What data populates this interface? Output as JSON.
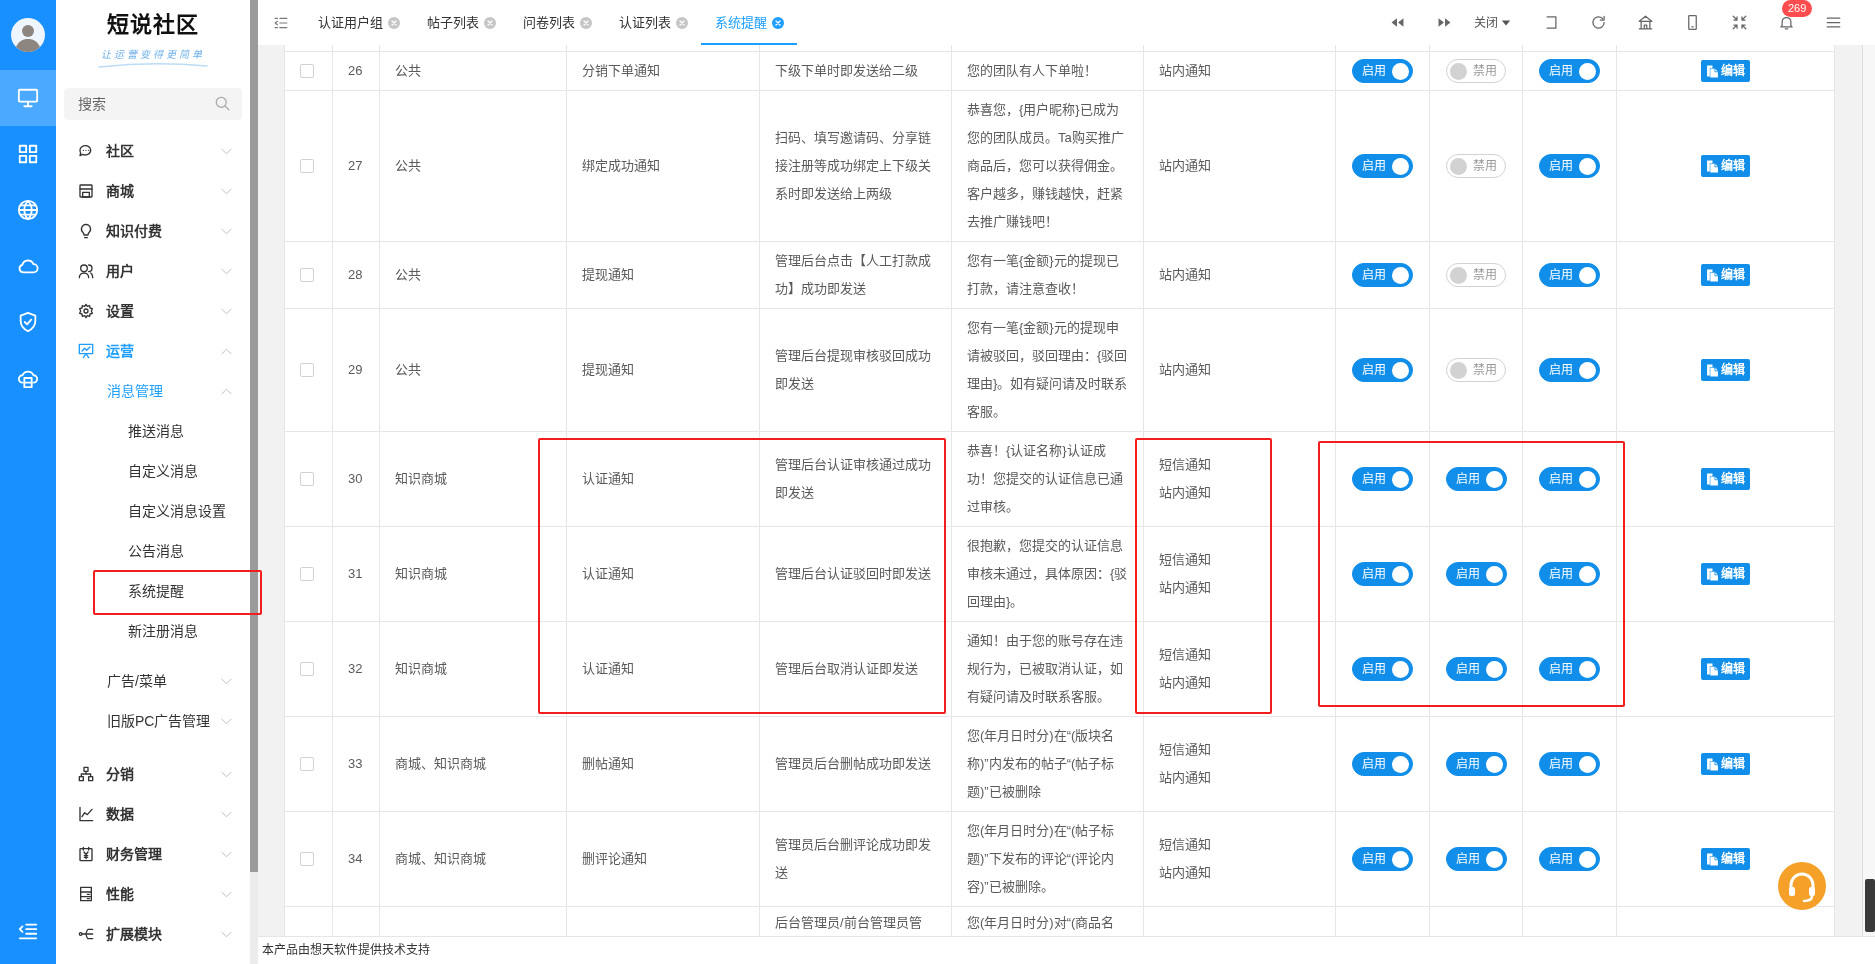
{
  "rail": {
    "items": [
      {
        "selected": true
      },
      {
        "selected": false
      },
      {
        "selected": false
      },
      {
        "selected": false
      },
      {
        "selected": false
      },
      {
        "selected": false
      }
    ]
  },
  "sidebar": {
    "logo": "短说社区",
    "tagline": "让运营变得更简单",
    "search": {
      "placeholder": "搜索"
    },
    "items": [
      {
        "label": "社区",
        "expanded": false
      },
      {
        "label": "商城",
        "expanded": false
      },
      {
        "label": "知识付费",
        "expanded": false
      },
      {
        "label": "用户",
        "expanded": false
      },
      {
        "label": "设置",
        "expanded": false
      },
      {
        "label": "运营",
        "expanded": true,
        "children": [
          {
            "label": "消息管理",
            "expanded": true,
            "children": [
              {
                "label": "推送消息",
                "selected": false,
                "framed": false
              },
              {
                "label": "自定义消息",
                "selected": false,
                "framed": false
              },
              {
                "label": "自定义消息设置",
                "selected": false,
                "framed": false
              },
              {
                "label": "公告消息",
                "selected": false,
                "framed": false
              },
              {
                "label": "系统提醒",
                "selected": false,
                "framed": true
              },
              {
                "label": "新注册消息",
                "selected": false,
                "framed": false
              }
            ]
          },
          {
            "label": "广告/菜单",
            "expanded": false
          },
          {
            "label": "旧版PC广告管理",
            "expanded": false
          }
        ]
      },
      {
        "label": "分销",
        "expanded": false
      },
      {
        "label": "数据",
        "expanded": false
      },
      {
        "label": "财务管理",
        "expanded": false
      },
      {
        "label": "性能",
        "expanded": false
      },
      {
        "label": "扩展模块",
        "expanded": false
      }
    ]
  },
  "tabs": [
    {
      "label": "认证用户组",
      "selected": false
    },
    {
      "label": "帖子列表",
      "selected": false
    },
    {
      "label": "问卷列表",
      "selected": false
    },
    {
      "label": "认证列表",
      "selected": false
    },
    {
      "label": "系统提醒",
      "selected": true
    }
  ],
  "toolbar": {
    "close_menu": "关闭",
    "notification_count": "269"
  },
  "table": {
    "frames": [
      {
        "kind": "text"
      },
      {
        "kind": "channels"
      },
      {
        "kind": "switches"
      }
    ],
    "rows": [
      {
        "checked": false,
        "id": "26",
        "category": "公共",
        "name": "分销下单通知",
        "trigger": "下级下单时即发送给二级",
        "content": "您的团队有人下单啦！",
        "channels": [
          "站内通知"
        ],
        "switches": [
          {
            "label": "启用",
            "on": true
          },
          {
            "label": "禁用",
            "on": false
          },
          {
            "label": "启用",
            "on": true
          }
        ],
        "action": "编辑",
        "framed": false
      },
      {
        "checked": false,
        "id": "27",
        "category": "公共",
        "name": "绑定成功通知",
        "trigger": "扫码、填写邀请码、分享链接注册等成功绑定上下级关系时即发送给上两级",
        "content": "恭喜您，{用户昵称}已成为您的团队成员。Ta购买推广商品后，您可以获得佣金。客户越多，赚钱越快，赶紧去推广赚钱吧！",
        "channels": [
          "站内通知"
        ],
        "switches": [
          {
            "label": "启用",
            "on": true
          },
          {
            "label": "禁用",
            "on": false
          },
          {
            "label": "启用",
            "on": true
          }
        ],
        "action": "编辑",
        "framed": false
      },
      {
        "checked": false,
        "id": "28",
        "category": "公共",
        "name": "提现通知",
        "trigger": "管理后台点击【人工打款成功】成功即发送",
        "content": "您有一笔{金额}元的提现已打款，请注意查收！",
        "channels": [
          "站内通知"
        ],
        "switches": [
          {
            "label": "启用",
            "on": true
          },
          {
            "label": "禁用",
            "on": false
          },
          {
            "label": "启用",
            "on": true
          }
        ],
        "action": "编辑",
        "framed": false
      },
      {
        "checked": false,
        "id": "29",
        "category": "公共",
        "name": "提现通知",
        "trigger": "管理后台提现审核驳回成功即发送",
        "content": "您有一笔{金额}元的提现申请被驳回，驳回理由：{驳回理由}。如有疑问请及时联系客服。",
        "channels": [
          "站内通知"
        ],
        "switches": [
          {
            "label": "启用",
            "on": true
          },
          {
            "label": "禁用",
            "on": false
          },
          {
            "label": "启用",
            "on": true
          }
        ],
        "action": "编辑",
        "framed": false
      },
      {
        "checked": false,
        "id": "30",
        "category": "知识商城",
        "name": "认证通知",
        "trigger": "管理后台认证审核通过成功即发送",
        "content": "恭喜！{认证名称}认证成功！您提交的认证信息已通过审核。",
        "channels": [
          "短信通知",
          "站内通知"
        ],
        "switches": [
          {
            "label": "启用",
            "on": true
          },
          {
            "label": "启用",
            "on": true
          },
          {
            "label": "启用",
            "on": true
          }
        ],
        "action": "编辑",
        "framed": true
      },
      {
        "checked": false,
        "id": "31",
        "category": "知识商城",
        "name": "认证通知",
        "trigger": "管理后台认证驳回时即发送",
        "content": "很抱歉，您提交的认证信息审核未通过，具体原因：{驳回理由}。",
        "channels": [
          "短信通知",
          "站内通知"
        ],
        "switches": [
          {
            "label": "启用",
            "on": true
          },
          {
            "label": "启用",
            "on": true
          },
          {
            "label": "启用",
            "on": true
          }
        ],
        "action": "编辑",
        "framed": true
      },
      {
        "checked": false,
        "id": "32",
        "category": "知识商城",
        "name": "认证通知",
        "trigger": "管理后台取消认证即发送",
        "content": "通知！由于您的账号存在违规行为，已被取消认证，如有疑问请及时联系客服。",
        "channels": [
          "短信通知",
          "站内通知"
        ],
        "switches": [
          {
            "label": "启用",
            "on": true
          },
          {
            "label": "启用",
            "on": true
          },
          {
            "label": "启用",
            "on": true
          }
        ],
        "action": "编辑",
        "framed": true
      },
      {
        "checked": false,
        "id": "33",
        "category": "商城、知识商城",
        "name": "删帖通知",
        "trigger": "管理员后台删帖成功即发送",
        "content": "您(年月日时分)在“(版块名称)”内发布的帖子“(帖子标题)”已被删除",
        "channels": [
          "短信通知",
          "站内通知"
        ],
        "switches": [
          {
            "label": "启用",
            "on": true
          },
          {
            "label": "启用",
            "on": true
          },
          {
            "label": "启用",
            "on": true
          }
        ],
        "action": "编辑",
        "framed": false
      },
      {
        "checked": false,
        "id": "34",
        "category": "商城、知识商城",
        "name": "删评论通知",
        "trigger": "管理员后台删评论成功即发送",
        "content": "您(年月日时分)在“(帖子标题)”下发布的评论“(评论内容)”已被删除。",
        "channels": [
          "短信通知",
          "站内通知"
        ],
        "switches": [
          {
            "label": "启用",
            "on": true
          },
          {
            "label": "启用",
            "on": true
          },
          {
            "label": "启用",
            "on": true
          }
        ],
        "action": "编辑",
        "framed": false
      },
      {
        "trigger": "后台管理员/前台管理员管",
        "content": "您(年月日时分)对“(商品名",
        "framed": false
      }
    ]
  },
  "footer": "本产品由想天软件提供技术支持"
}
